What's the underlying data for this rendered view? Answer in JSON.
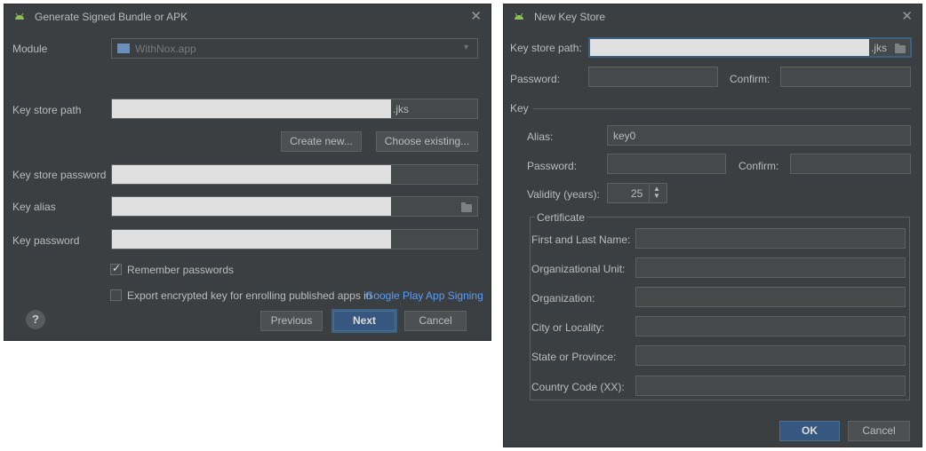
{
  "left_dialog": {
    "title": "Generate Signed Bundle or APK",
    "close": "✕",
    "module": {
      "label": "Module",
      "value": "WithNox.app"
    },
    "key_store_path": {
      "label": "Key store path",
      "suffix": ".jks"
    },
    "create_new": "Create new...",
    "choose_existing": "Choose existing...",
    "key_store_password": {
      "label": "Key store password"
    },
    "key_alias": {
      "label": "Key alias"
    },
    "key_password": {
      "label": "Key password"
    },
    "remember_passwords": {
      "label": "Remember passwords",
      "checked": true
    },
    "export_encrypted": {
      "label": "Export encrypted key for enrolling published apps in",
      "link": "Google Play App Signing",
      "checked": false
    },
    "help": "?",
    "previous": "Previous",
    "next": "Next",
    "cancel": "Cancel"
  },
  "right_dialog": {
    "title": "New Key Store",
    "close": "✕",
    "key_store_path": {
      "label": "Key store path:",
      "suffix": ".jks"
    },
    "password": {
      "label": "Password:"
    },
    "confirm": {
      "label": "Confirm:"
    },
    "key_section": "Key",
    "alias": {
      "label": "Alias:",
      "value": "key0"
    },
    "key_password": {
      "label": "Password:"
    },
    "key_confirm": {
      "label": "Confirm:"
    },
    "validity": {
      "label": "Validity (years):",
      "value": "25"
    },
    "certificate": {
      "title": "Certificate",
      "fields": [
        {
          "label": "First and Last Name:"
        },
        {
          "label": "Organizational Unit:"
        },
        {
          "label": "Organization:"
        },
        {
          "label": "City or Locality:"
        },
        {
          "label": "State or Province:"
        },
        {
          "label": "Country Code (XX):"
        }
      ]
    },
    "ok": "OK",
    "cancel": "Cancel"
  },
  "colors": {
    "dialog_bg": "#3c3f41",
    "field_bg": "#45494a",
    "primary_button": "#365880",
    "link": "#589df6"
  },
  "icons": {
    "title": "android-icon",
    "folder": "folder-icon",
    "module": "module-icon",
    "help": "help-icon"
  }
}
